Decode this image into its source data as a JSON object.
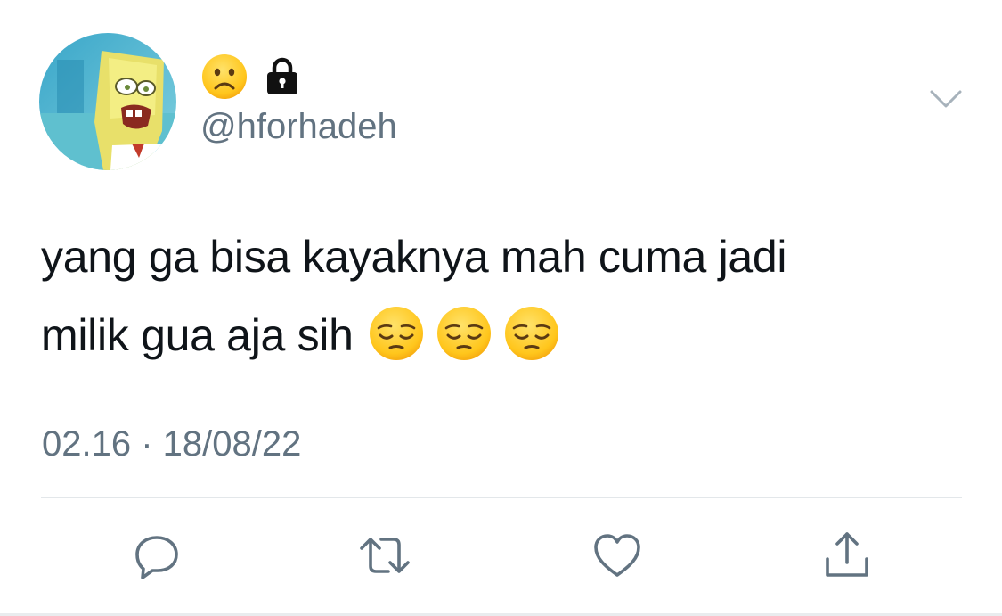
{
  "tweet": {
    "display_name_emoji": "sad-face-emoji",
    "protected_icon": "lock-icon",
    "handle": "@hforhadeh",
    "text_line1": "yang ga bisa kayaknya mah cuma jadi",
    "text_line2": "milik gua aja sih",
    "trailing_emojis": [
      "pensive-face-emoji",
      "pensive-face-emoji",
      "pensive-face-emoji"
    ],
    "timestamp": "02.16 · 18/08/22"
  },
  "actions": [
    {
      "name": "reply",
      "icon": "reply-icon"
    },
    {
      "name": "retweet",
      "icon": "retweet-icon"
    },
    {
      "name": "like",
      "icon": "heart-icon"
    },
    {
      "name": "share",
      "icon": "share-icon"
    }
  ],
  "colors": {
    "text": "#0f1419",
    "secondary": "#627381",
    "divider": "#e3e7ea",
    "icon": "#627381"
  }
}
